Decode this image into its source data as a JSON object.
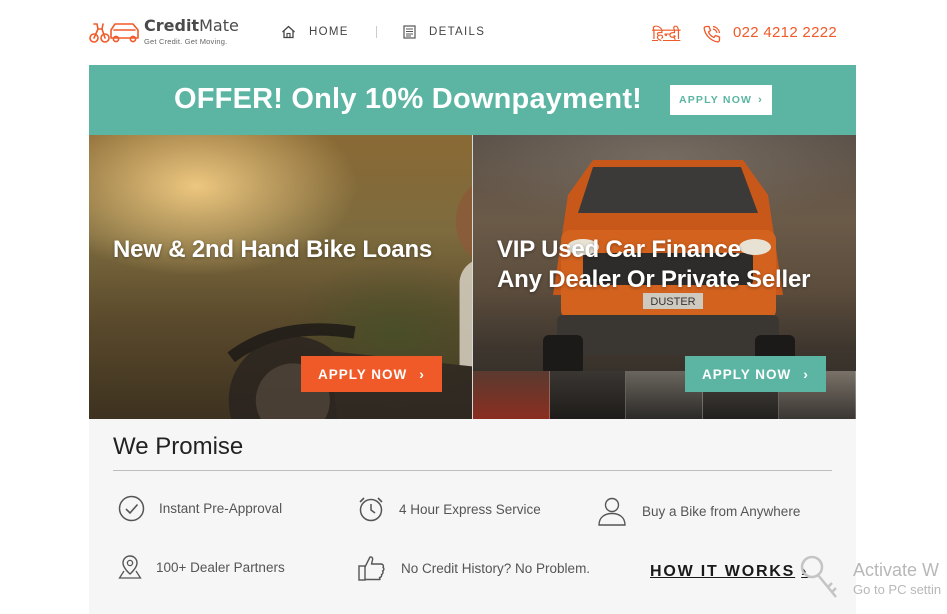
{
  "header": {
    "logo_name_bold": "Credit",
    "logo_name_rest": "Mate",
    "logo_tagline": "Get Credit. Get Moving.",
    "nav": [
      {
        "label": "HOME",
        "icon": "home-icon"
      },
      {
        "label": "DETAILS",
        "icon": "document-icon"
      }
    ],
    "language_link": "हिन्दी",
    "phone": "022 4212 2222"
  },
  "offer": {
    "text": "OFFER! Only 10% Downpayment!",
    "button_label": "APPLY NOW"
  },
  "hero": {
    "left": {
      "title": "New & 2nd Hand Bike Loans",
      "button_label": "APPLY NOW"
    },
    "right": {
      "title_line1": "VIP Used Car Finance",
      "title_line2": "Any Dealer Or Private Seller",
      "plate": "DUSTER",
      "button_label": "APPLY NOW"
    }
  },
  "promise": {
    "title": "We Promise",
    "features": [
      {
        "label": "Instant Pre-Approval",
        "icon": "check-circle-icon"
      },
      {
        "label": "4 Hour Express Service",
        "icon": "alarm-clock-icon"
      },
      {
        "label": "Buy a Bike from Anywhere",
        "icon": "user-icon"
      },
      {
        "label": "100+ Dealer Partners",
        "icon": "map-pin-icon"
      },
      {
        "label": "No Credit History? No Problem.",
        "icon": "thumbs-up-icon"
      }
    ],
    "how_it_works": "HOW IT WORKS"
  },
  "watermark": {
    "title": "Activate W",
    "subtitle": "Go to PC settin"
  },
  "colors": {
    "accent_orange": "#f05a28",
    "accent_teal": "#5bb5a2"
  }
}
